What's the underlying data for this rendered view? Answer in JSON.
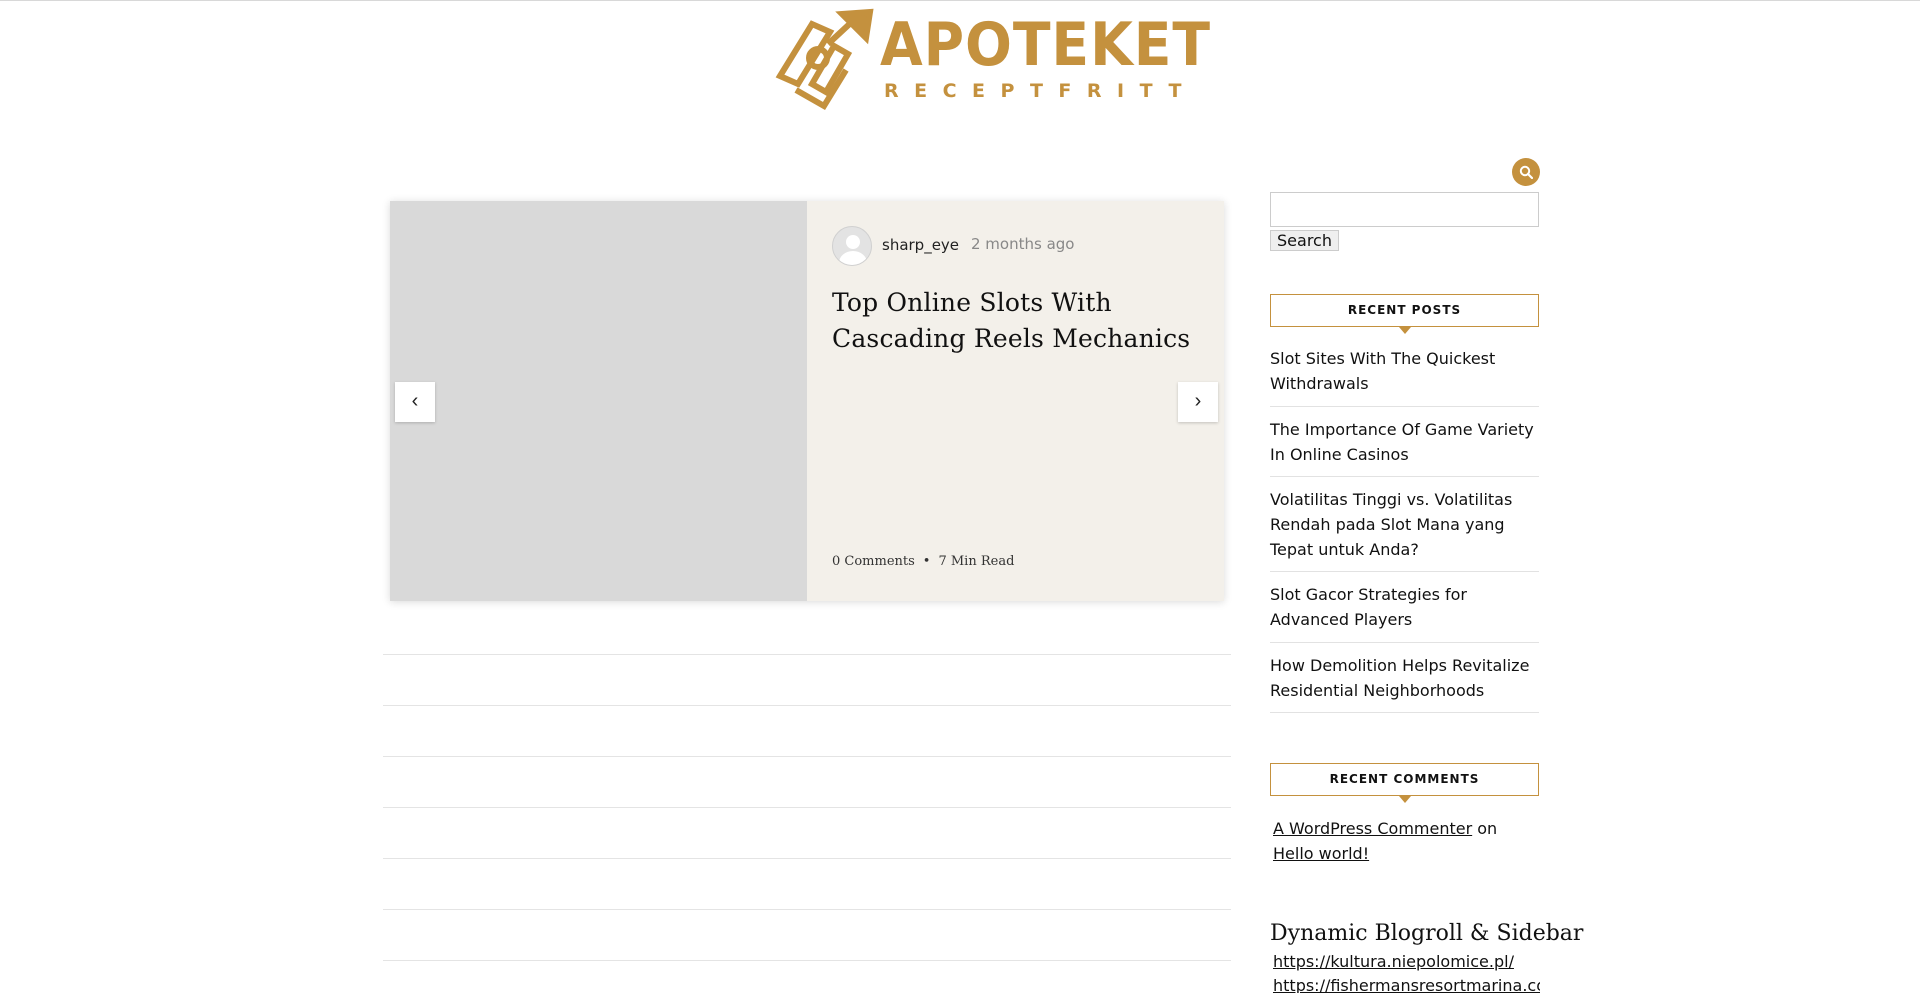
{
  "brand": {
    "title": "APOTEKET",
    "subtitle": "RECEPTFRITT",
    "accent_color": "#c4913e",
    "logo_icon": "rocket-arrow-logo-icon"
  },
  "slider": {
    "author": "sharp_eye",
    "date": "2 months ago",
    "post_title": "Top Online Slots With Cascading Reels Mechanics",
    "comments": "0 Comments",
    "separator": "•",
    "read_time": "7 Min Read",
    "prev_label": "‹",
    "next_label": "›"
  },
  "sidebar": {
    "search_icon": "search-icon",
    "search_button": "Search",
    "search_value": "",
    "recent_posts": {
      "heading": "RECENT POSTS",
      "items": [
        "Slot Sites With The Quickest Withdrawals",
        "The Importance Of Game Variety In Online Casinos",
        "Volatilitas Tinggi vs. Volatilitas Rendah pada Slot Mana yang Tepat untuk Anda?",
        "Slot Gacor Strategies for Advanced Players",
        "How Demolition Helps Revitalize Residential Neighborhoods"
      ]
    },
    "recent_comments": {
      "heading": "RECENT COMMENTS",
      "commenter": "A WordPress Commenter",
      "on": "on",
      "post": "Hello world!"
    },
    "blogroll": {
      "title": "Dynamic Blogroll & Sidebar",
      "links": [
        "https://kultura.niepolomice.pl/",
        "https://fishermansresortmarina.com/"
      ]
    }
  }
}
